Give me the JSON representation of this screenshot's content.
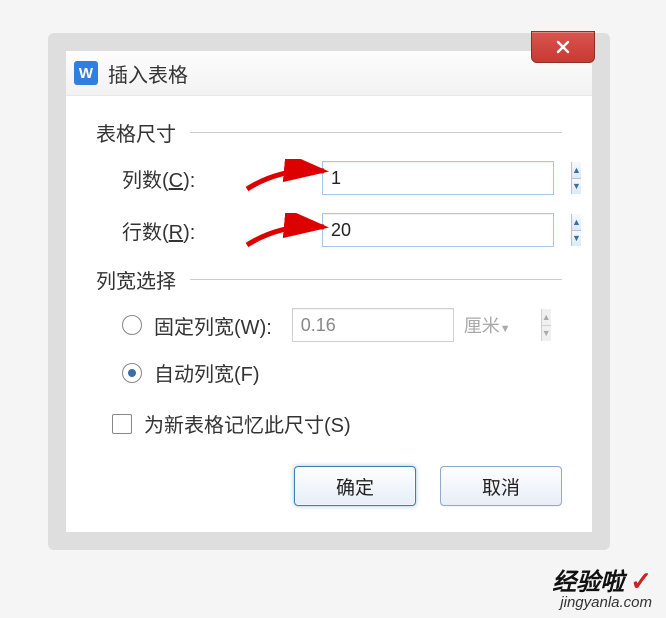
{
  "title": "插入表格",
  "group_size": "表格尺寸",
  "columns_label_pre": "列数(",
  "columns_label_ul": "C",
  "columns_label_post": "):",
  "columns_value": "1",
  "rows_label_pre": "行数(",
  "rows_label_ul": "R",
  "rows_label_post": "):",
  "rows_value": "20",
  "group_width": "列宽选择",
  "fixed_label_pre": "固定列宽(",
  "fixed_label_ul": "W",
  "fixed_label_post": "):",
  "fixed_value": "0.16",
  "unit": "厘米",
  "auto_label_pre": "自动列宽(",
  "auto_label_ul": "F",
  "auto_label_post": ")",
  "remember_pre": "为新表格记忆此尺寸(",
  "remember_ul": "S",
  "remember_post": ")",
  "ok": "确定",
  "cancel": "取消",
  "wm_cn": "经验啦",
  "wm_en": "jingyanla.com",
  "colors": {
    "accent": "#3a6ea5",
    "close": "#c83a32"
  }
}
